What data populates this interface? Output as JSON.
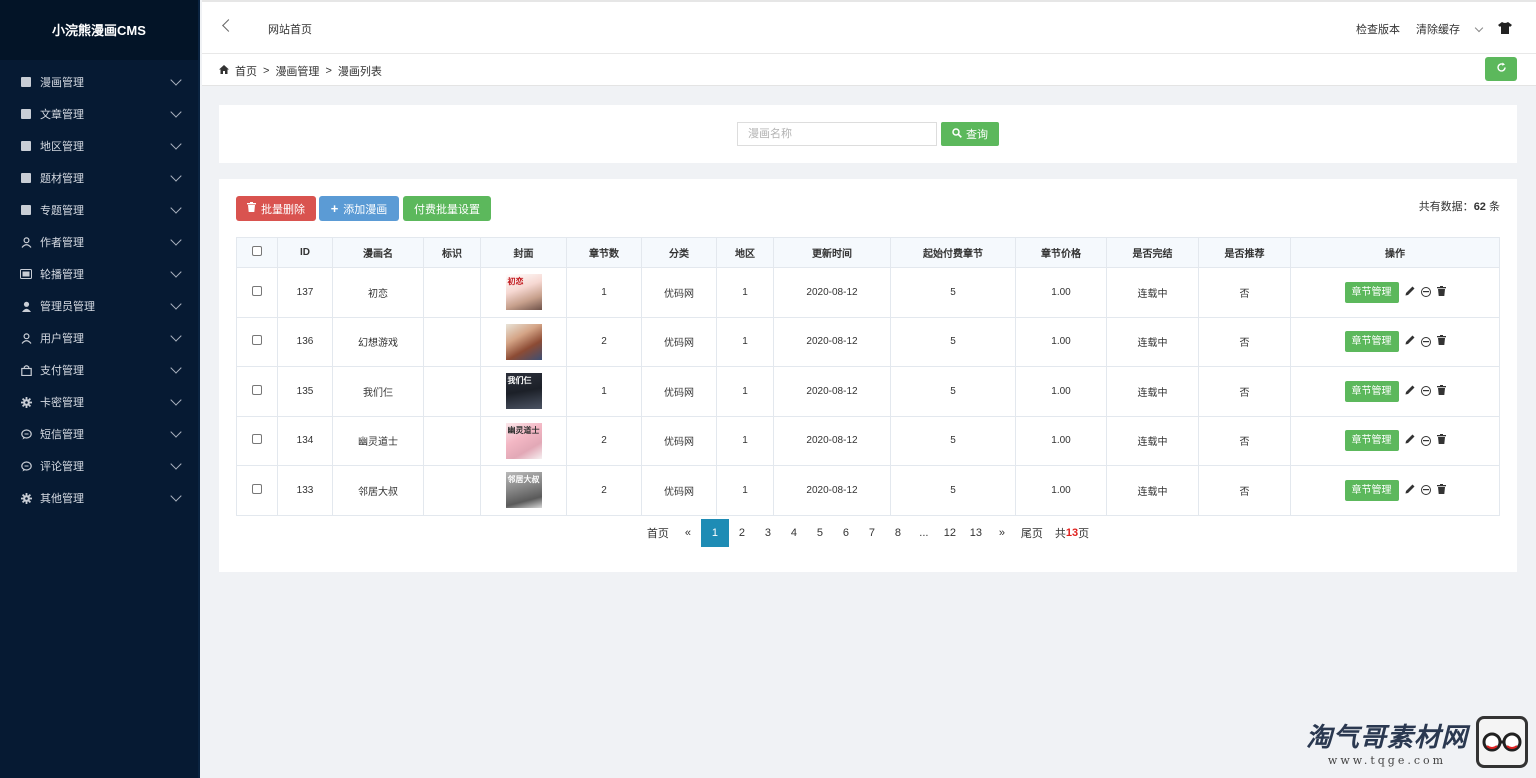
{
  "app": {
    "title": "小浣熊漫画CMS"
  },
  "sidebar": {
    "items": [
      {
        "label": "漫画管理",
        "icon": "book-icon"
      },
      {
        "label": "文章管理",
        "icon": "book-icon"
      },
      {
        "label": "地区管理",
        "icon": "book-icon"
      },
      {
        "label": "题材管理",
        "icon": "book-icon"
      },
      {
        "label": "专题管理",
        "icon": "book-icon"
      },
      {
        "label": "作者管理",
        "icon": "user-outline-icon"
      },
      {
        "label": "轮播管理",
        "icon": "carousel-icon"
      },
      {
        "label": "管理员管理",
        "icon": "user-icon"
      },
      {
        "label": "用户管理",
        "icon": "user-outline-icon"
      },
      {
        "label": "支付管理",
        "icon": "shopping-bag-icon"
      },
      {
        "label": "卡密管理",
        "icon": "gear-icon"
      },
      {
        "label": "短信管理",
        "icon": "chat-icon"
      },
      {
        "label": "评论管理",
        "icon": "chat-icon"
      },
      {
        "label": "其他管理",
        "icon": "gear-icon"
      }
    ]
  },
  "topbar": {
    "site_home": "网站首页",
    "check_version": "检查版本",
    "clear_cache": "清除缓存"
  },
  "breadcrumb": [
    "首页",
    "漫画管理",
    "漫画列表"
  ],
  "search": {
    "placeholder": "漫画名称",
    "button": "查询"
  },
  "toolbar": {
    "batch_delete": "批量删除",
    "add_comic": "添加漫画",
    "batch_pay": "付费批量设置",
    "total_prefix": "共有数据：",
    "total_count": "62",
    "total_suffix": "条"
  },
  "table": {
    "headers": [
      "ID",
      "漫画名",
      "标识",
      "封面",
      "章节数",
      "分类",
      "地区",
      "更新时间",
      "起始付费章节",
      "章节价格",
      "是否完结",
      "是否推荐",
      "操作"
    ],
    "action_label": "章节管理",
    "rows": [
      {
        "id": "137",
        "name": "初恋",
        "tag": "",
        "cover_text": "初恋",
        "chapters": "1",
        "category": "优码网",
        "region": "1",
        "updated": "2020-08-12",
        "pay_start": "5",
        "price": "1.00",
        "finished": "连载中",
        "recommended": "否"
      },
      {
        "id": "136",
        "name": "幻想游戏",
        "tag": "",
        "cover_text": "",
        "chapters": "2",
        "category": "优码网",
        "region": "1",
        "updated": "2020-08-12",
        "pay_start": "5",
        "price": "1.00",
        "finished": "连载中",
        "recommended": "否"
      },
      {
        "id": "135",
        "name": "我们仨",
        "tag": "",
        "cover_text": "我们仨",
        "chapters": "1",
        "category": "优码网",
        "region": "1",
        "updated": "2020-08-12",
        "pay_start": "5",
        "price": "1.00",
        "finished": "连载中",
        "recommended": "否"
      },
      {
        "id": "134",
        "name": "幽灵道士",
        "tag": "",
        "cover_text": "幽灵道士",
        "chapters": "2",
        "category": "优码网",
        "region": "1",
        "updated": "2020-08-12",
        "pay_start": "5",
        "price": "1.00",
        "finished": "连载中",
        "recommended": "否"
      },
      {
        "id": "133",
        "name": "邻居大叔",
        "tag": "",
        "cover_text": "邻居大叔",
        "chapters": "2",
        "category": "优码网",
        "region": "1",
        "updated": "2020-08-12",
        "pay_start": "5",
        "price": "1.00",
        "finished": "连载中",
        "recommended": "否"
      }
    ]
  },
  "pager": {
    "first": "首页",
    "prev": "«",
    "pages": [
      "1",
      "2",
      "3",
      "4",
      "5",
      "6",
      "7",
      "8",
      "...",
      "12",
      "13"
    ],
    "next": "»",
    "last": "尾页",
    "total_prefix": "共",
    "total_pages": "13",
    "total_suffix": "页"
  },
  "watermark": {
    "title": "淘气哥素材网",
    "url": "www.tqge.com"
  }
}
